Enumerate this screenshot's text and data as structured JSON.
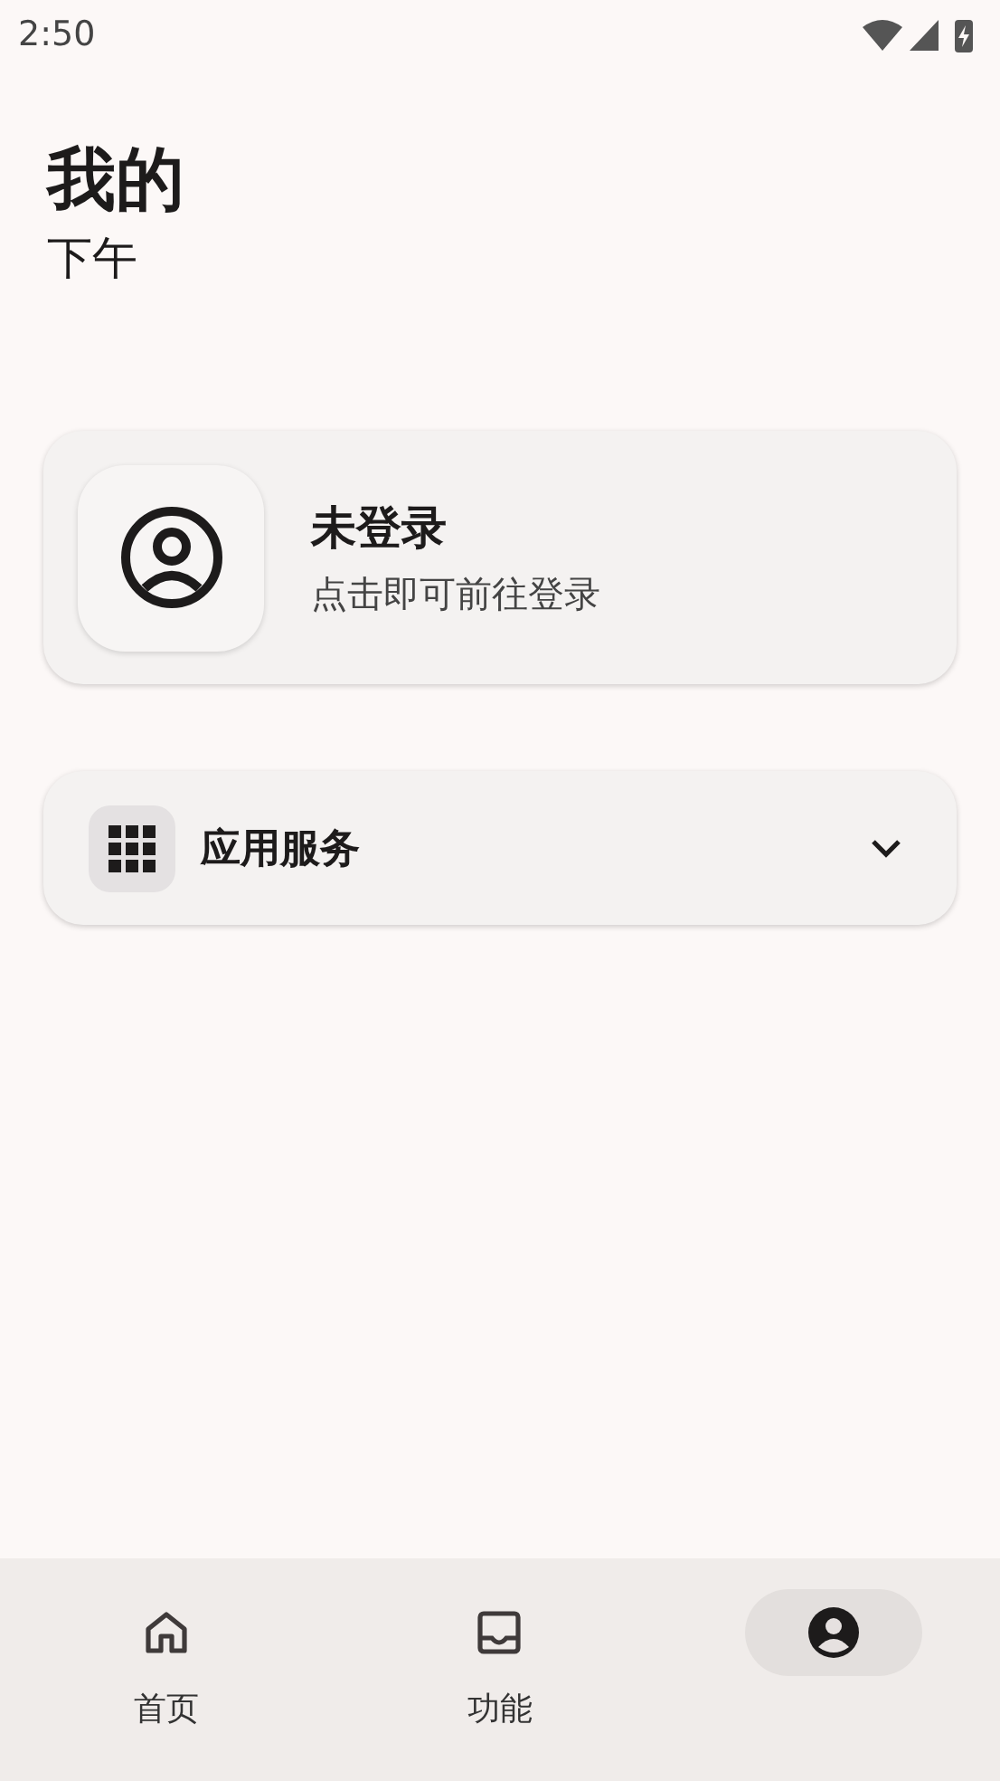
{
  "status_bar": {
    "time": "2:50"
  },
  "header": {
    "title": "我的",
    "subtitle": "下午"
  },
  "account_card": {
    "name": "未登录",
    "hint": "点击即可前往登录"
  },
  "services": {
    "label": "应用服务",
    "expanded": false
  },
  "bottom_nav": [
    {
      "kind": "home",
      "label": "首页",
      "selected": false
    },
    {
      "kind": "features",
      "label": "功能",
      "selected": false
    },
    {
      "kind": "profile",
      "selected": true
    }
  ]
}
